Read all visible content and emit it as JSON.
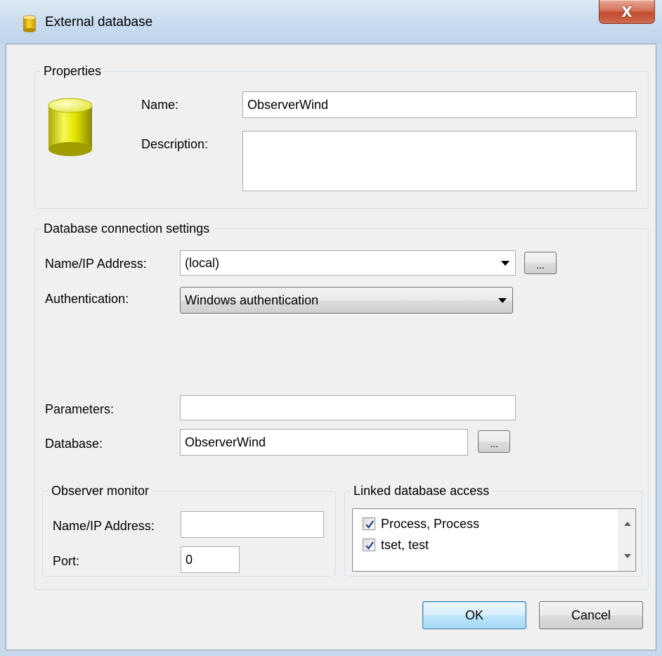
{
  "window": {
    "title": "External database",
    "close_glyph": "X"
  },
  "properties": {
    "group_label": "Properties",
    "name_label": "Name:",
    "name_value": "ObserverWind",
    "description_label": "Description:",
    "description_value": ""
  },
  "connection": {
    "group_label": "Database connection settings",
    "name_ip_label": "Name/IP Address:",
    "name_ip_value": "(local)",
    "browse_label": "...",
    "authentication_label": "Authentication:",
    "authentication_value": "Windows authentication",
    "parameters_label": "Parameters:",
    "parameters_value": "",
    "database_label": "Database:",
    "database_value": "ObserverWind",
    "database_browse_label": "..."
  },
  "observer_monitor": {
    "group_label": "Observer monitor",
    "name_ip_label": "Name/IP Address:",
    "name_ip_value": "",
    "port_label": "Port:",
    "port_value": "0"
  },
  "linked_access": {
    "group_label": "Linked database access",
    "items": [
      {
        "label": "Process, Process",
        "checked": true
      },
      {
        "label": "tset, test",
        "checked": true
      }
    ]
  },
  "buttons": {
    "ok": "OK",
    "cancel": "Cancel"
  },
  "icons": {
    "title": "database-icon",
    "properties": "database-cylinder-icon"
  },
  "colors": {
    "cylinder_yellow": "#e8e800",
    "default_button_border": "#3c7fb1",
    "checkbox_check": "#2a4d8f"
  }
}
